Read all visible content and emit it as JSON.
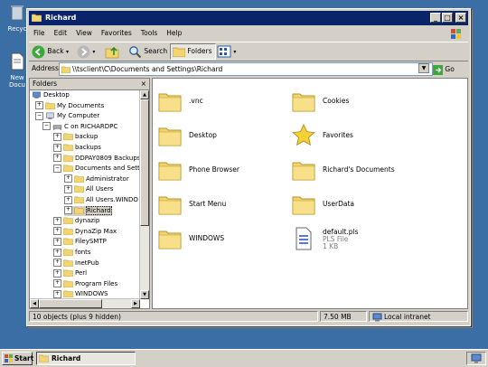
{
  "desktop": {
    "icons": [
      {
        "label": "Recyc",
        "icon": "recycle-bin-icon"
      },
      {
        "label": "New Docu",
        "icon": "document-icon"
      }
    ]
  },
  "window": {
    "title": "Richard",
    "controls": {
      "minimize": "_",
      "maximize": "□",
      "close": "×"
    },
    "menu": [
      "File",
      "Edit",
      "View",
      "Favorites",
      "Tools",
      "Help"
    ],
    "toolbar": {
      "back": "Back",
      "search": "Search",
      "folders": "Folders"
    },
    "address": {
      "label": "Address",
      "value": "\\\\tsclient\\C\\Documents and Settings\\Richard",
      "go": "Go"
    },
    "folders_pane": {
      "title": "Folders",
      "close": "×",
      "tree": [
        {
          "label": "Desktop",
          "expander": ""
        },
        {
          "label": "My Documents",
          "expander": "+"
        },
        {
          "label": "My Computer",
          "expander": "−"
        },
        {
          "label": "C on RICHARDPC",
          "expander": "−"
        },
        {
          "label": "backup",
          "expander": "+"
        },
        {
          "label": "backups",
          "expander": "+"
        },
        {
          "label": "DDPAY0809 Backups",
          "expander": "+"
        },
        {
          "label": "Documents and Setti",
          "expander": "−"
        },
        {
          "label": "Administrator",
          "expander": "+"
        },
        {
          "label": "All Users",
          "expander": "+"
        },
        {
          "label": "All Users.WINDO",
          "expander": "+"
        },
        {
          "label": "Richard",
          "expander": "+"
        },
        {
          "label": "dynazip",
          "expander": "+"
        },
        {
          "label": "DynaZip Max",
          "expander": "+"
        },
        {
          "label": "FileySMTP",
          "expander": "+"
        },
        {
          "label": "fonts",
          "expander": "+"
        },
        {
          "label": "InetPub",
          "expander": "+"
        },
        {
          "label": "Perl",
          "expander": "+"
        },
        {
          "label": "Program Files",
          "expander": "+"
        },
        {
          "label": "WINDOWS",
          "expander": "+"
        }
      ]
    },
    "content": {
      "items": [
        {
          "label": ".vnc",
          "icon": "folder-icon"
        },
        {
          "label": "Cookies",
          "icon": "folder-icon"
        },
        {
          "label": "Desktop",
          "icon": "folder-icon"
        },
        {
          "label": "Favorites",
          "icon": "star-icon"
        },
        {
          "label": "Phone Browser",
          "icon": "folder-icon"
        },
        {
          "label": "Richard's Documents",
          "icon": "folder-icon"
        },
        {
          "label": "Start Menu",
          "icon": "folder-icon"
        },
        {
          "label": "UserData",
          "icon": "folder-icon"
        },
        {
          "label": "WINDOWS",
          "icon": "folder-icon"
        },
        {
          "label": "default.pls",
          "icon": "file-icon",
          "type": "PLS File",
          "size": "1 KB"
        }
      ]
    },
    "status": {
      "objects": "10 objects (plus 9 hidden)",
      "size": "7.50 MB",
      "zone": "Local intranet"
    }
  },
  "taskbar": {
    "start": "Start",
    "tasks": [
      "Richard"
    ]
  }
}
